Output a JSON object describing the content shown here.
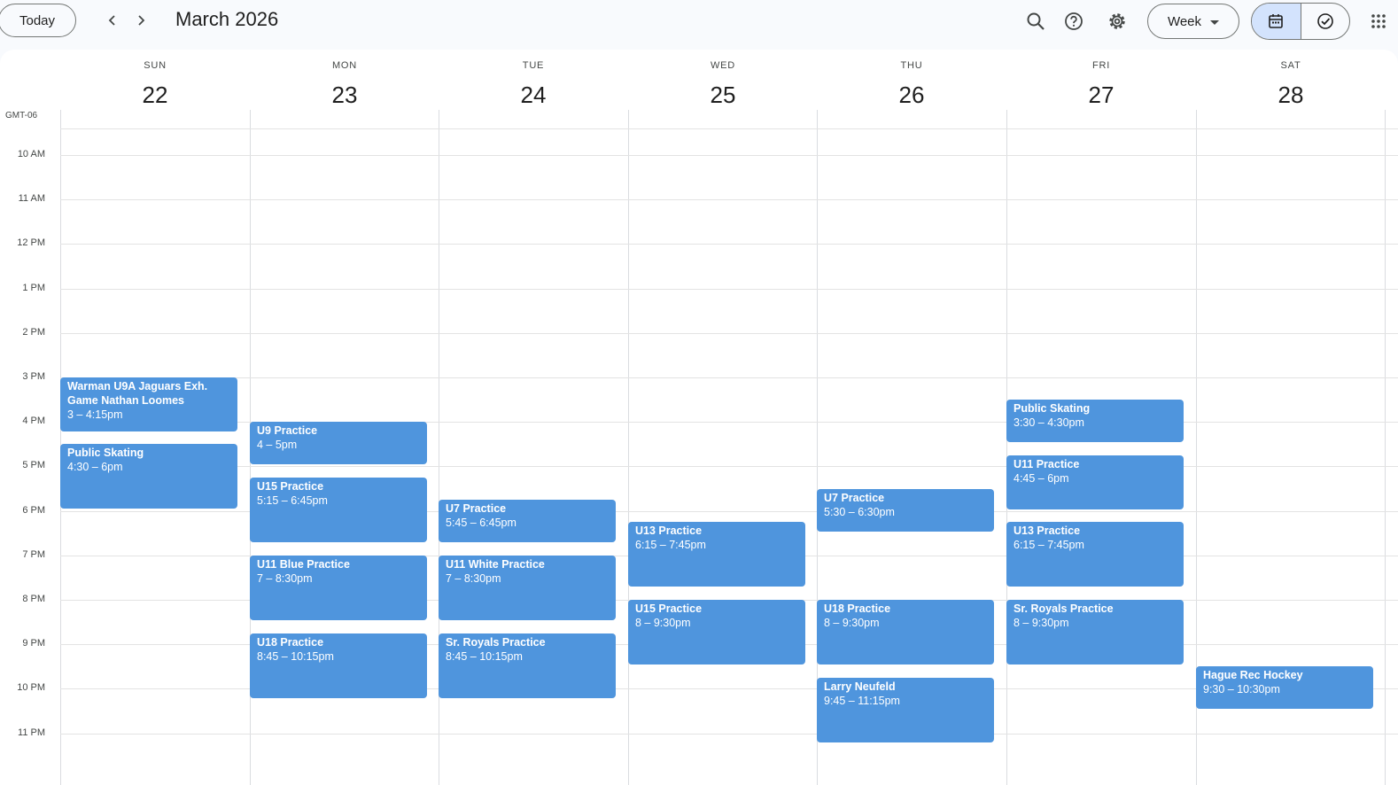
{
  "header": {
    "today_label": "Today",
    "title": "March 2026",
    "view_label": "Week",
    "icons": [
      "chevron-left-icon",
      "chevron-right-icon",
      "search-icon",
      "help-icon",
      "gear-icon",
      "dropdown-caret-icon",
      "calendar-icon",
      "task-check-icon",
      "apps-grid-icon"
    ]
  },
  "timezone": "GMT-06",
  "days": [
    {
      "dow": "SUN",
      "num": "22"
    },
    {
      "dow": "MON",
      "num": "23"
    },
    {
      "dow": "TUE",
      "num": "24"
    },
    {
      "dow": "WED",
      "num": "25"
    },
    {
      "dow": "THU",
      "num": "26"
    },
    {
      "dow": "FRI",
      "num": "27"
    },
    {
      "dow": "SAT",
      "num": "28"
    }
  ],
  "hours": [
    "10 AM",
    "11 AM",
    "12 PM",
    "1 PM",
    "2 PM",
    "3 PM",
    "4 PM",
    "5 PM",
    "6 PM",
    "7 PM",
    "8 PM",
    "9 PM",
    "10 PM",
    "11 PM"
  ],
  "events": [
    {
      "day": 0,
      "start": 15.0,
      "end": 16.25,
      "title": "Warman U9A Jaguars Exh. Game Nathan Loomes",
      "time": "3 – 4:15pm"
    },
    {
      "day": 0,
      "start": 16.5,
      "end": 18.0,
      "title": "Public Skating",
      "time": "4:30 – 6pm"
    },
    {
      "day": 1,
      "start": 16.0,
      "end": 17.0,
      "title": "U9 Practice",
      "time": "4 – 5pm"
    },
    {
      "day": 1,
      "start": 17.25,
      "end": 18.75,
      "title": "U15 Practice",
      "time": "5:15 – 6:45pm"
    },
    {
      "day": 1,
      "start": 19.0,
      "end": 20.5,
      "title": "U11 Blue Practice",
      "time": "7 – 8:30pm"
    },
    {
      "day": 1,
      "start": 20.75,
      "end": 22.25,
      "title": "U18 Practice",
      "time": "8:45 – 10:15pm"
    },
    {
      "day": 2,
      "start": 17.75,
      "end": 18.75,
      "title": "U7 Practice",
      "time": "5:45 – 6:45pm"
    },
    {
      "day": 2,
      "start": 19.0,
      "end": 20.5,
      "title": "U11 White Practice",
      "time": "7 – 8:30pm"
    },
    {
      "day": 2,
      "start": 20.75,
      "end": 22.25,
      "title": "Sr. Royals Practice",
      "time": "8:45 – 10:15pm"
    },
    {
      "day": 3,
      "start": 18.25,
      "end": 19.75,
      "title": "U13 Practice",
      "time": "6:15 – 7:45pm"
    },
    {
      "day": 3,
      "start": 20.0,
      "end": 21.5,
      "title": "U15 Practice",
      "time": "8 – 9:30pm"
    },
    {
      "day": 4,
      "start": 17.5,
      "end": 18.5,
      "title": "U7 Practice",
      "time": "5:30 – 6:30pm"
    },
    {
      "day": 4,
      "start": 20.0,
      "end": 21.5,
      "title": "U18 Practice",
      "time": "8 – 9:30pm"
    },
    {
      "day": 4,
      "start": 21.75,
      "end": 23.25,
      "title": "Larry Neufeld",
      "time": "9:45 – 11:15pm"
    },
    {
      "day": 5,
      "start": 15.5,
      "end": 16.5,
      "title": "Public Skating",
      "time": "3:30 – 4:30pm"
    },
    {
      "day": 5,
      "start": 16.75,
      "end": 18.0,
      "title": "U11 Practice",
      "time": "4:45 – 6pm"
    },
    {
      "day": 5,
      "start": 18.25,
      "end": 19.75,
      "title": "U13 Practice",
      "time": "6:15 – 7:45pm"
    },
    {
      "day": 5,
      "start": 20.0,
      "end": 21.5,
      "title": "Sr. Royals Practice",
      "time": "8 – 9:30pm"
    },
    {
      "day": 6,
      "start": 21.5,
      "end": 22.5,
      "title": "Hague Rec Hockey",
      "time": "9:30 – 10:30pm"
    }
  ],
  "colors": {
    "event": "#4f95dd",
    "event_text": "#ffffff",
    "accent": "#d3e3fd"
  }
}
